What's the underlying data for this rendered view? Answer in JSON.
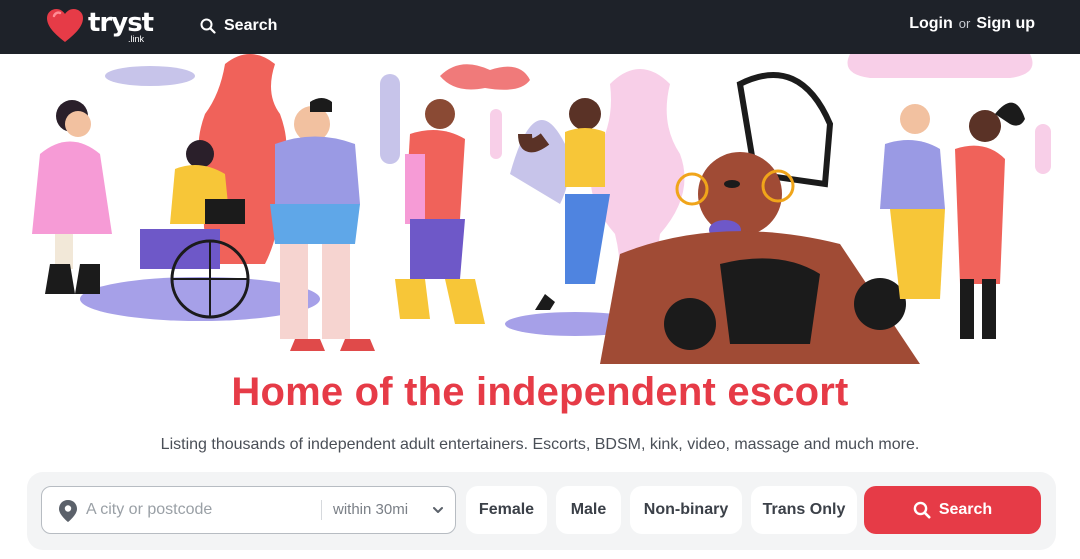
{
  "nav": {
    "logo_text": "tryst",
    "logo_sub": ".link",
    "search_label": "Search",
    "login_label": "Login",
    "or_label": "or",
    "signup_label": "Sign up"
  },
  "hero": {
    "headline": "Home of the independent escort",
    "subline": "Listing thousands of independent adult entertainers. Escorts, BDSM, kink, video, massage and much more."
  },
  "search": {
    "location_placeholder": "A city or postcode",
    "location_value": "",
    "radius_label": "within 30mi",
    "filters": [
      "Female",
      "Male",
      "Non-binary",
      "Trans Only"
    ],
    "button_label": "Search"
  },
  "colors": {
    "brand": "#e63b47",
    "navbar": "#1e2229"
  }
}
